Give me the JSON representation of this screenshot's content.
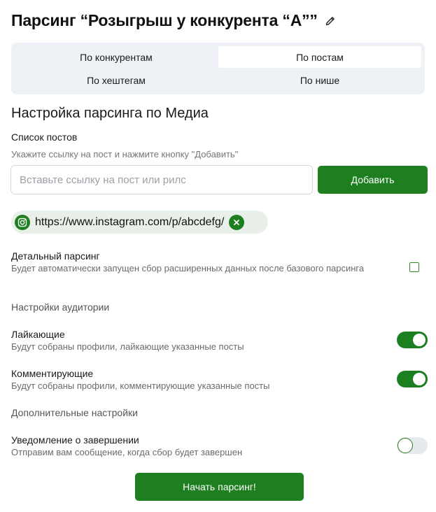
{
  "header": {
    "title": "Парсинг “Розыгрыш у конкурента “А””"
  },
  "tabs": [
    {
      "label": "По конкурентам",
      "active": false
    },
    {
      "label": "По постам",
      "active": true
    },
    {
      "label": "По хештегам",
      "active": false
    },
    {
      "label": "По нише",
      "active": false
    }
  ],
  "section": {
    "title": "Настройка парсинга по Медиа"
  },
  "posts": {
    "label": "Список постов",
    "hint": "Укажите ссылку на пост и нажмите кнопку \"Добавить\"",
    "input_value": "",
    "input_placeholder": "Вставьте ссылку на пост или рилс",
    "add_label": "Добавить",
    "items": [
      {
        "url": "https://www.instagram.com/p/abcdefg/"
      }
    ]
  },
  "detailed": {
    "title": "Детальный парсинг",
    "desc": "Будет автоматически запущен сбор расширенных данных после базового парсинга",
    "checked": false
  },
  "audience": {
    "heading": "Настройки аудитории",
    "likers": {
      "title": "Лайкающие",
      "desc": "Будут собраны профили, лайкающие указанные посты",
      "on": true
    },
    "commenters": {
      "title": "Комментирующие",
      "desc": "Будут собраны профили, комментирующие указанные посты",
      "on": true
    }
  },
  "extra": {
    "heading": "Дополнительные настройки",
    "notify": {
      "title": "Уведомление о завершении",
      "desc": "Отправим вам сообщение, когда сбор будет завершен",
      "on": false
    }
  },
  "start_label": "Начать парсинг!",
  "colors": {
    "accent": "#1d7f1f",
    "tabs_bg": "#eef1f6",
    "chip_bg": "#e9f0ea"
  },
  "icons": {
    "edit": "pencil-icon",
    "instagram": "instagram-icon",
    "remove": "close-icon"
  }
}
